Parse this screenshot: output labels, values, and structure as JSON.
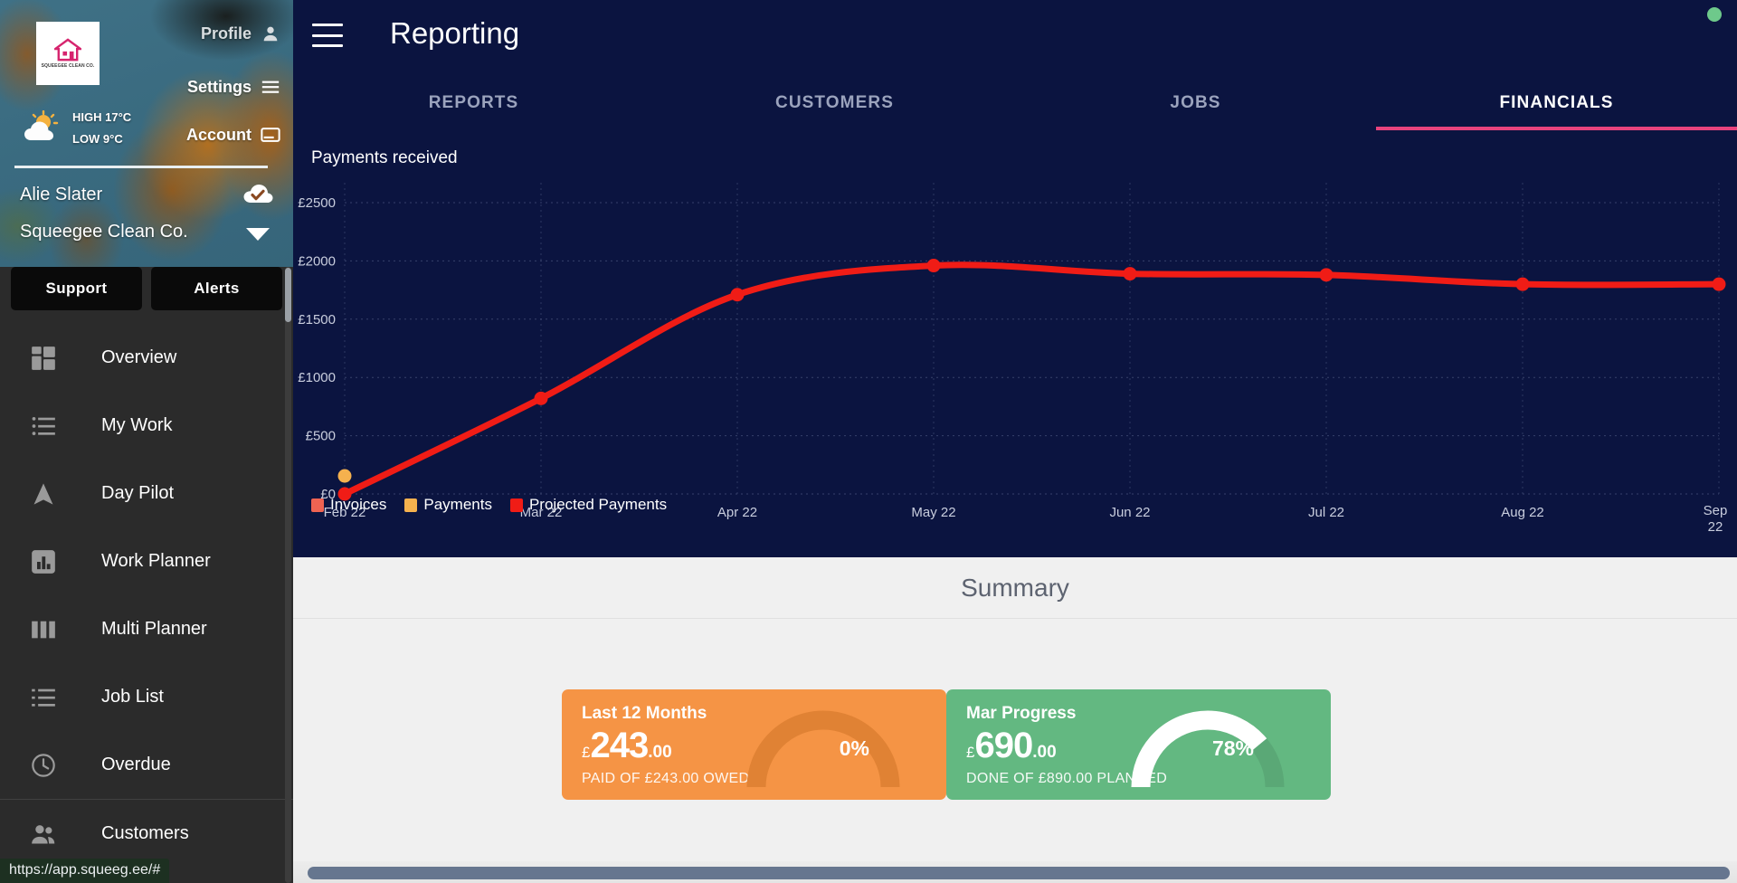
{
  "sidebar": {
    "logo_text": "SQUEEGEE CLEAN CO.",
    "links": [
      {
        "label": "Profile",
        "icon": "person-icon"
      },
      {
        "label": "Settings",
        "icon": "list-settings-icon"
      },
      {
        "label": "Account",
        "icon": "card-icon"
      }
    ],
    "weather": {
      "high": "HIGH 17°C",
      "low": "LOW 9°C",
      "icon": "sun-cloud-icon"
    },
    "user_name": "Alie Slater",
    "company_name": "Squeegee Clean Co.",
    "sync_icon": "cloud-check-icon",
    "dropdown_icon": "caret-down-icon",
    "buttons": [
      {
        "label": "Support"
      },
      {
        "label": "Alerts"
      }
    ],
    "nav": [
      {
        "label": "Overview",
        "icon": "dashboard-grid-icon"
      },
      {
        "label": "My Work",
        "icon": "bullet-list-icon"
      },
      {
        "label": "Day Pilot",
        "icon": "navigation-arrow-icon"
      },
      {
        "label": "Work Planner",
        "icon": "bar-chart-icon"
      },
      {
        "label": "Multi Planner",
        "icon": "columns-icon"
      },
      {
        "label": "Job List",
        "icon": "list-icon"
      },
      {
        "label": "Overdue",
        "icon": "clock-icon"
      },
      {
        "label": "Customers",
        "icon": "people-icon"
      }
    ]
  },
  "status_bar": {
    "url": "https://app.squeeg.ee/#"
  },
  "header": {
    "menu_icon": "hamburger-icon",
    "title": "Reporting",
    "status_indicator": "online-dot"
  },
  "tabs": [
    {
      "label": "REPORTS",
      "active": false
    },
    {
      "label": "CUSTOMERS",
      "active": false
    },
    {
      "label": "JOBS",
      "active": false
    },
    {
      "label": "FINANCIALS",
      "active": true
    }
  ],
  "chart_data": {
    "type": "line",
    "title": "Payments received",
    "xlabel": "",
    "ylabel": "",
    "x": [
      "Feb 22",
      "Mar 22",
      "Apr 22",
      "May 22",
      "Jun 22",
      "Jul 22",
      "Aug 22",
      "Sep 22"
    ],
    "ylim": [
      0,
      2500
    ],
    "yticks": [
      0,
      500,
      1000,
      1500,
      2000,
      2500
    ],
    "ytick_labels": [
      "£0",
      "£500",
      "£1000",
      "£1500",
      "£2000",
      "£2500"
    ],
    "grid": true,
    "legend_position": "bottom-left",
    "series": [
      {
        "name": "Invoices",
        "color": "#ef6352",
        "values": [
          null,
          null,
          null,
          null,
          null,
          null,
          null,
          null
        ]
      },
      {
        "name": "Payments",
        "color": "#f5b14e",
        "values": [
          155,
          null,
          null,
          null,
          null,
          null,
          null,
          null
        ]
      },
      {
        "name": "Projected Payments",
        "color": "#f01c16",
        "values": [
          0,
          820,
          1710,
          1960,
          1890,
          1880,
          1800,
          1800
        ]
      }
    ]
  },
  "summary": {
    "title": "Summary",
    "cards": [
      {
        "title": "Last 12 Months",
        "currency": "£",
        "amount": "243",
        "decimals": ".00",
        "subtitle": "PAID OF £243.00 OWED",
        "percent": "0%",
        "percent_value": 0,
        "bg_color": "#f59445",
        "track_color": "#e08234"
      },
      {
        "title": "Mar Progress",
        "currency": "£",
        "amount": "690",
        "decimals": ".00",
        "subtitle": "DONE OF £890.00 PLANNED",
        "percent": "78%",
        "percent_value": 78,
        "bg_color": "#63b881",
        "track_color": "#5aa876"
      }
    ]
  }
}
